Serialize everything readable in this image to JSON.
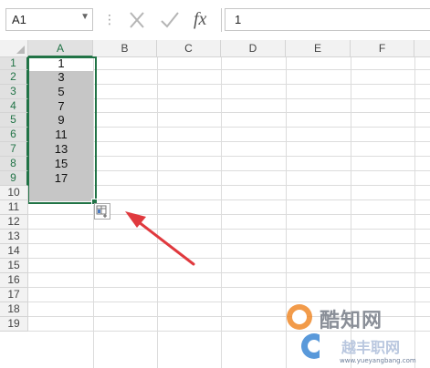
{
  "formula_bar": {
    "name_box": "A1",
    "name_box_arrow": "▼",
    "more_dots": "⋮",
    "cancel_icon": "close-icon",
    "enter_icon": "check-icon",
    "function_label": "fx",
    "formula_value": "1"
  },
  "columns": [
    "A",
    "B",
    "C",
    "D",
    "E",
    "F"
  ],
  "rows": [
    "1",
    "2",
    "3",
    "4",
    "5",
    "6",
    "7",
    "8",
    "9",
    "10",
    "11",
    "12",
    "13",
    "14",
    "15",
    "16",
    "17",
    "18",
    "19"
  ],
  "cells_a": [
    "1",
    "3",
    "5",
    "7",
    "9",
    "11",
    "13",
    "15",
    "17"
  ],
  "colors": {
    "selection_border": "#217346",
    "selection_fill": "#c6c6c6",
    "arrow": "#e0393e"
  },
  "watermark": {
    "name": "酷知网",
    "sub": "越丰职网",
    "url": "www.yueyangbang.com"
  }
}
